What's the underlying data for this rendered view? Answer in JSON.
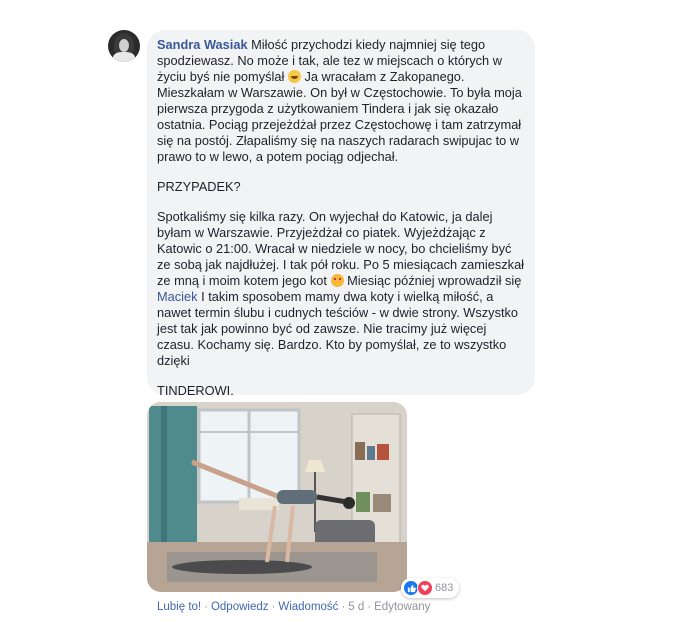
{
  "comment": {
    "author": "Sandra Wasiak",
    "p1_a": "Miłość przychodzi kiedy najmniej się tego spodziewasz. No może i tak, ale tez w miejscach o których w życiu byś nie pomyślał",
    "p1_b": "Ja wracałam z Zakopanego. Mieszkałam w Warszawie. On był w Częstochowie. To była moja pierwsza przygoda z użytkowaniem Tindera i jak się okazało ostatnia. Pociąg przejeżdżał przez Częstochowę i tam zatrzymał się na postój. Złapaliśmy się na naszych radarach swipujac to w prawo to w lewo, a potem pociąg odjechał.",
    "p2": "PRZYPADEK?",
    "p3_a": "Spotkaliśmy się kilka razy. On wyjechał do Katowic, ja dalej byłam w Warszawie. Przyjeżdżał co piatek. Wyjeżdżając z Katowic o 21:00. Wracał w niedziele w nocy, bo chcieliśmy być ze sobą jak najdłużej. I tak pół roku. Po 5 miesiącach zamieszkał ze mną i moim kotem jego kot",
    "p3_b": "Miesiąc później wprowadził się",
    "mention": "Maciek",
    "p3_c": "I takim sposobem mamy dwa koty i wielką miłość, a nawet termin ślubu i cudnych teściów - w dwie strony. Wszystko jest tak jak powinno być od zawsze. Nie tracimy już więcej czasu. Kochamy się. Bardzo. Kto by pomyślał, ze to wszystko dzięki",
    "p4": "TINDEROWI.",
    "emoji_1": "grinning-face-emoji",
    "emoji_2": "heart-eyes-cat-emoji"
  },
  "reactions": {
    "count": "683",
    "icons": [
      "like-icon",
      "love-icon"
    ]
  },
  "actions": {
    "like": "Lubię to!",
    "reply": "Odpowiedz",
    "message": "Wiadomość",
    "time": "5 d",
    "edited": "Edytowany",
    "separator": "·"
  },
  "colors": {
    "link": "#385898",
    "bubble": "#f2f3f5",
    "meta": "#90949c",
    "like": "#1877f2",
    "love": "#f33e58"
  }
}
